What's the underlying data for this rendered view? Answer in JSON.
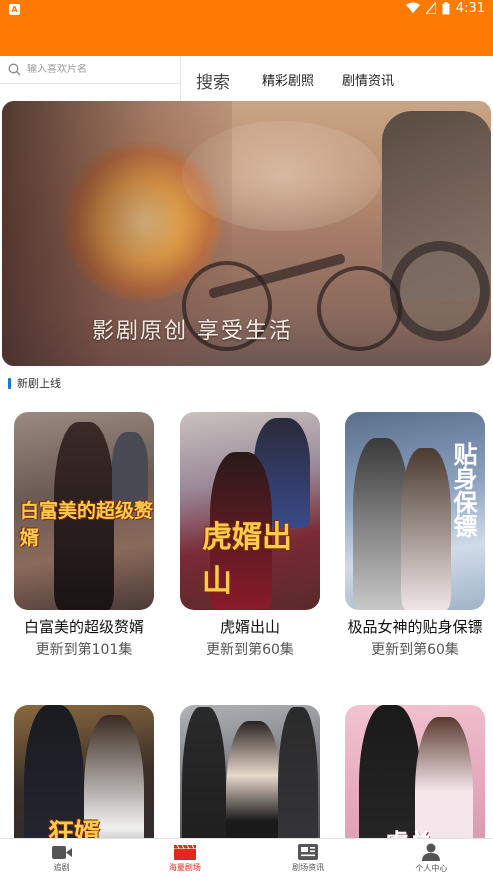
{
  "status_bar": {
    "time": "4:31",
    "app_badge": "A"
  },
  "search": {
    "placeholder": "输入喜欢片名",
    "button_label": "搜索"
  },
  "top_nav": [
    {
      "label": "精彩剧照"
    },
    {
      "label": "剧情资讯"
    }
  ],
  "banner": {
    "caption": "影剧原创 享受生活"
  },
  "section": {
    "title": "新剧上线"
  },
  "dramas": [
    {
      "title": "白富美的超级赘婿",
      "subtitle": "更新到第101集",
      "poster_art": "白富美的超级赘婿"
    },
    {
      "title": "虎婿出山",
      "subtitle": "更新到第60集",
      "poster_art": "虎婿出山"
    },
    {
      "title": "极品女神的贴身保镖",
      "subtitle": "更新到第60集",
      "poster_art": "贴身保镖"
    },
    {
      "title": "",
      "subtitle": "",
      "poster_art": "狂婿"
    },
    {
      "title": "",
      "subtitle": "",
      "poster_art": ""
    },
    {
      "title": "",
      "subtitle": "",
      "poster_art": "虞总"
    }
  ],
  "tabs": [
    {
      "label": "追剧",
      "icon": "video-icon"
    },
    {
      "label": "海量剧场",
      "icon": "clapperboard-icon",
      "active": true
    },
    {
      "label": "剧场资讯",
      "icon": "news-icon"
    },
    {
      "label": "个人中心",
      "icon": "person-icon"
    }
  ],
  "colors": {
    "header": "#ff7a00",
    "active_tab": "#e0281e",
    "section_bar": "#1976d2"
  }
}
